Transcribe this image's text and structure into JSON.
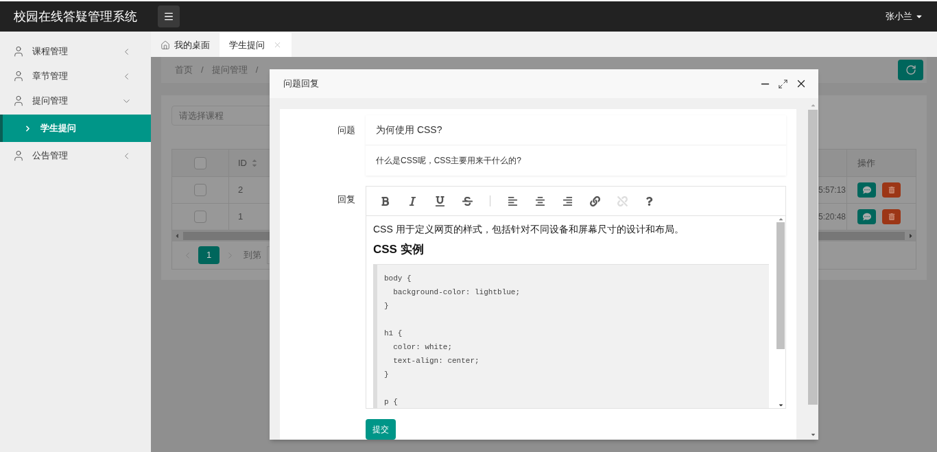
{
  "app": {
    "title": "校园在线答疑管理系统",
    "user": "张小兰"
  },
  "sidebar": {
    "items": [
      {
        "label": "课程管理",
        "expanded": false
      },
      {
        "label": "章节管理",
        "expanded": false
      },
      {
        "label": "提问管理",
        "expanded": true,
        "children": [
          {
            "label": "学生提问",
            "selected": true
          }
        ]
      },
      {
        "label": "公告管理",
        "expanded": false
      }
    ]
  },
  "tabs": [
    {
      "label": "我的桌面",
      "kind": "home",
      "selected": false
    },
    {
      "label": "学生提问",
      "kind": "closable",
      "selected": true
    }
  ],
  "breadcrumb": [
    {
      "kind": "link",
      "text": "首页"
    },
    {
      "kind": "separator",
      "text": "/"
    },
    {
      "kind": "link",
      "text": "提问管理"
    },
    {
      "kind": "separator",
      "text": "/"
    }
  ],
  "filter": {
    "placeholder": "请选择课程"
  },
  "table": {
    "select_all": {
      "checked": false
    },
    "columns": [
      "ID",
      "操作"
    ],
    "rows": [
      {
        "id": "2",
        "column_3": "5:57:13",
        "checked": false
      },
      {
        "id": "1",
        "column_3": "5:20:48",
        "checked": false
      }
    ]
  },
  "pagination": {
    "pages": [
      {
        "label": "1",
        "selected": true
      }
    ],
    "goto_label": "到第"
  },
  "dialog": {
    "title": "问题回复",
    "question_label": "问题",
    "question_title": "为何使用 CSS?",
    "question_body": "什么是CSS呢，CSS主要用来干什么的?",
    "reply_label": "回复",
    "toolbar": [
      {
        "kind": "bold",
        "disabled": false
      },
      {
        "kind": "italic",
        "disabled": false
      },
      {
        "kind": "underline",
        "disabled": false
      },
      {
        "kind": "strike",
        "disabled": false
      },
      {
        "kind": "divider"
      },
      {
        "kind": "align-left",
        "disabled": false
      },
      {
        "kind": "align-center",
        "disabled": false
      },
      {
        "kind": "align-right",
        "disabled": false
      },
      {
        "kind": "link",
        "disabled": false
      },
      {
        "kind": "unlink",
        "disabled": true
      },
      {
        "kind": "help",
        "disabled": false
      }
    ],
    "reply": {
      "paragraph": "CSS 用于定义网页的样式，包括针对不同设备和屏幕尺寸的设计和布局。",
      "heading": "CSS 实例",
      "code": "body {\n  background-color: lightblue;\n}\n\nh1 {\n  color: white;\n  text-align: center;\n}\n\np {"
    },
    "submit": "提交"
  }
}
